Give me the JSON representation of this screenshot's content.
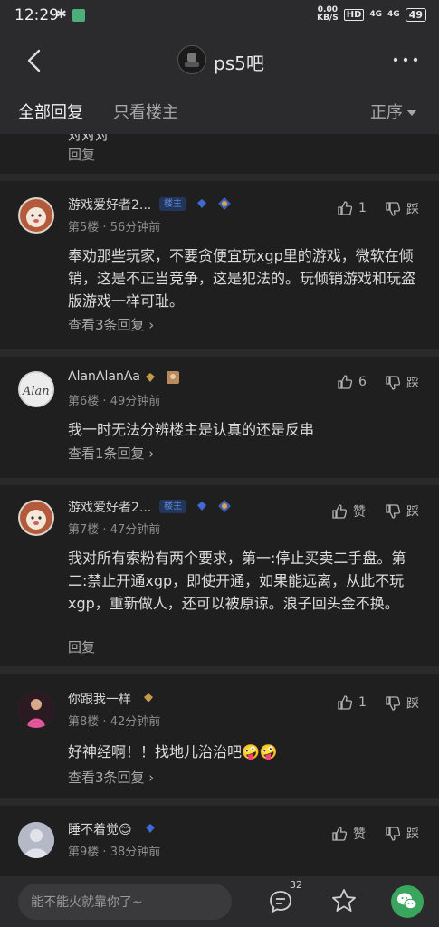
{
  "status": {
    "time": "12:29",
    "speed": "0.00",
    "speed_unit": "KB/S",
    "hd": "HD",
    "net1": "4G",
    "net2": "4G",
    "battery": "49"
  },
  "nav": {
    "title": "ps5吧"
  },
  "tabs": {
    "all": "全部回复",
    "owner_only": "只看楼主",
    "sort": "正序"
  },
  "top_fragment": {
    "text": "对对对",
    "reply": "回复"
  },
  "posts": [
    {
      "user": "游戏爱好者2...",
      "badge": "楼主",
      "floor": "第5楼",
      "time": "56分钟前",
      "likes": "1",
      "dislike": "踩",
      "body": "奉劝那些玩家，不要贪便宜玩xgp里的游戏，微软在倾销，这是不正当竞争，这是犯法的。玩倾销游戏和玩盗版游戏一样可耻。",
      "more": "查看3条回复 ›"
    },
    {
      "user": "AlanAlanAa",
      "floor": "第6楼",
      "time": "49分钟前",
      "likes": "6",
      "dislike": "踩",
      "body": "我一时无法分辨楼主是认真的还是反串",
      "more": "查看1条回复 ›"
    },
    {
      "user": "游戏爱好者2...",
      "badge": "楼主",
      "floor": "第7楼",
      "time": "47分钟前",
      "likes": "赞",
      "dislike": "踩",
      "body": "我对所有索粉有两个要求，第一:停止买卖二手盘。第二:禁止开通xgp，即使开通，如果能远离，从此不玩xgp，重新做人，还可以被原谅。浪子回头金不换。",
      "reply": "回复"
    },
    {
      "user": "你跟我一样",
      "floor": "第8楼",
      "time": "42分钟前",
      "likes": "1",
      "dislike": "踩",
      "body": "好神经啊！！找地儿治治吧🤪🤪",
      "more": "查看3条回复 ›"
    },
    {
      "user": "睡不着觉😊",
      "floor": "第9楼",
      "time": "38分钟前",
      "likes": "赞",
      "dislike": "踩"
    }
  ],
  "bottom": {
    "placeholder": "能不能火就靠你了~",
    "comment_count": "32"
  },
  "colors": {
    "background": "#1f1f20",
    "accent": "#3aa55d",
    "badge": "#5b88d8"
  }
}
